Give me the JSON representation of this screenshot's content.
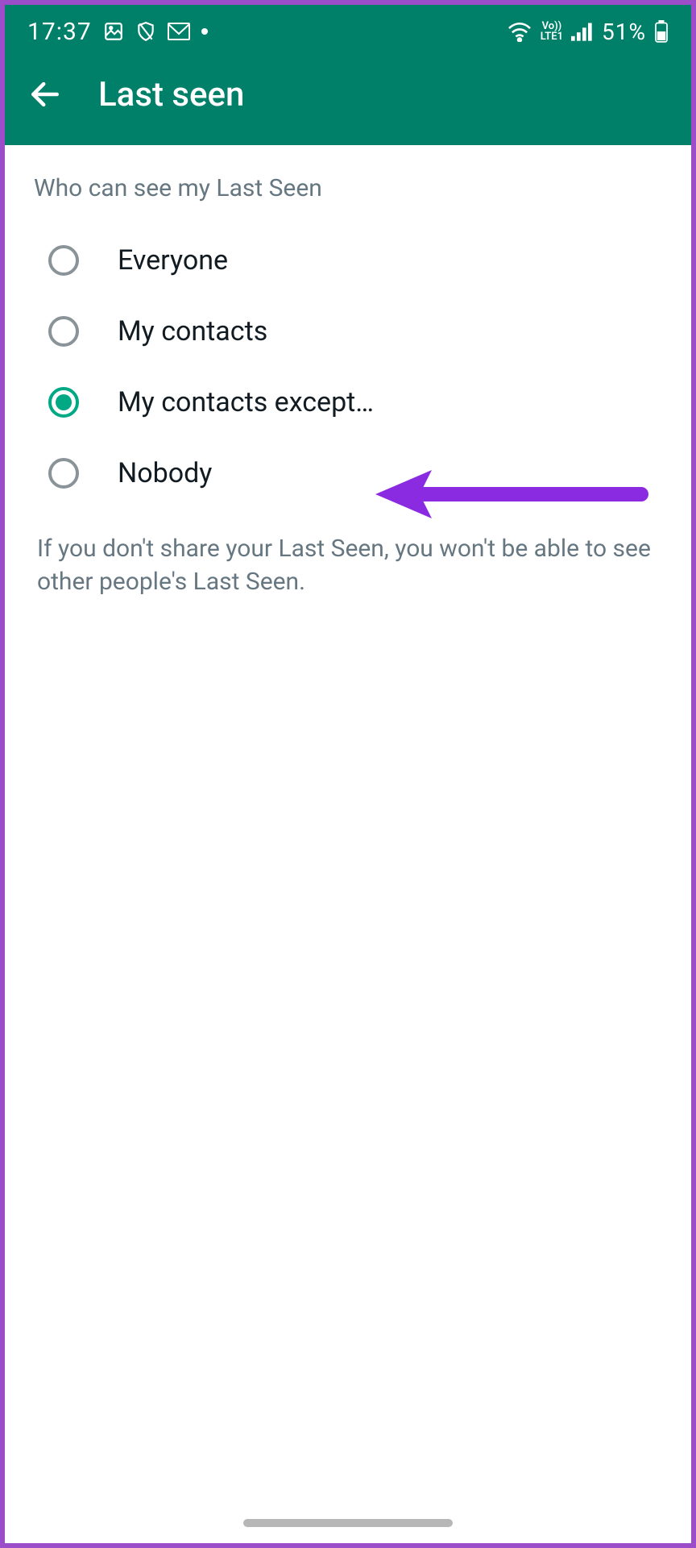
{
  "status": {
    "time": "17:37",
    "battery_text": "51%",
    "lte_label": "LTE1",
    "vo_label": "Vo))"
  },
  "appbar": {
    "title": "Last seen"
  },
  "section": {
    "title": "Who can see my Last Seen"
  },
  "options": [
    {
      "label": "Everyone",
      "selected": false
    },
    {
      "label": "My contacts",
      "selected": false
    },
    {
      "label": "My contacts except…",
      "selected": true
    },
    {
      "label": "Nobody",
      "selected": false
    }
  ],
  "footer_note": "If you don't share your Last Seen, you won't be able to see other people's Last Seen.",
  "colors": {
    "brand": "#008069",
    "accent": "#00a884",
    "annotation": "#8a2be2"
  }
}
